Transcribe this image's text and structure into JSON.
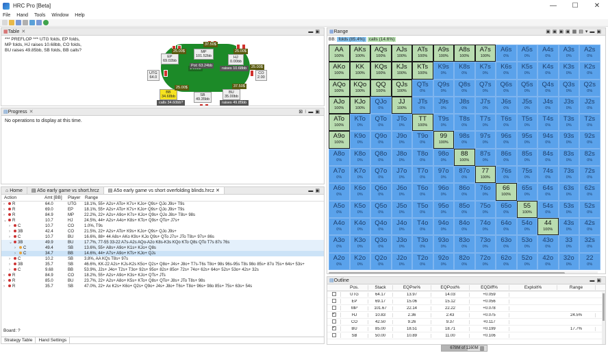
{
  "window": {
    "title": "HRC Pro [Beta]",
    "controls": [
      "—",
      "☐",
      "✕"
    ]
  },
  "menu": [
    "File",
    "Hand",
    "Tools",
    "Window",
    "Help"
  ],
  "panes": {
    "table": {
      "title": "Table",
      "preflop": "*** PREFLOP *** UTG folds, EP folds, MP folds, HJ raises 10.68bb, CO folds, BU raises 49.85bb, SB folds, BB calls?",
      "seats": [
        {
          "id": "ep",
          "name": "EP",
          "stack": "69.02bb"
        },
        {
          "id": "mp",
          "name": "MP",
          "stack": "101.52bb"
        },
        {
          "id": "hj",
          "name": "HJ",
          "stack": "0.00bb"
        },
        {
          "id": "utg",
          "name": "UTG",
          "stack": "64.0"
        },
        {
          "id": "co",
          "name": "CO",
          "stack": "2.00"
        },
        {
          "id": "bb",
          "name": "BB",
          "stack": "34.68bb"
        },
        {
          "id": "sb",
          "name": "SB",
          "stack": "49.35bb"
        },
        {
          "id": "bu",
          "name": "BU",
          "stack": "35.00bb"
        }
      ],
      "chips": [
        "25.00$",
        "37.50$",
        "25.00$",
        "25.00$",
        "37.50$",
        "25.00$"
      ],
      "pot": "Pot:  63.24bb",
      "blind_lbl": "1.00bb",
      "actions": {
        "hj": "raises 10.68bb",
        "bb": "calls 34.60bb?",
        "bu": "raises 49.85bb"
      }
    },
    "progress": {
      "title": "Progress",
      "message": "No operations to display at this time."
    },
    "range": {
      "title": "Range",
      "prefix": "BB:",
      "folds": "folds (85.4%)",
      "calls": "calls (14.6%)"
    },
    "outline": {
      "title": "Outline"
    }
  },
  "editor_tabs": [
    {
      "label": "Home",
      "active": false
    },
    {
      "label": "A5o early game vs short.hrcz",
      "active": false
    },
    {
      "label": "A5o early game vs short overfolding blinds.hrcz",
      "active": true
    }
  ],
  "strategy": {
    "headers": {
      "action": "Action",
      "amt": "Amt [BB]",
      "player": "Player",
      "range": "Range"
    },
    "rows": [
      {
        "indent": 0,
        "arrow": "›",
        "act": "R",
        "amt": "64.0",
        "player": "UTG",
        "range": "18.1%, 55+ A2s+ ATo+ K7s+ KJo+ Q9s+ QJo J9s+ T9s",
        "type": "normal",
        "dot": "#c33"
      },
      {
        "indent": 0,
        "arrow": "›",
        "act": "R",
        "amt": "69.0",
        "player": "EP",
        "range": "18.1%, 55+ A2s+ ATo+ K7s+ KJo+ Q9s+ QJo J9s+ T9s",
        "type": "normal",
        "dot": "#c33"
      },
      {
        "indent": 0,
        "arrow": "›",
        "act": "R",
        "amt": "84.9",
        "player": "MP",
        "range": "22.2%, 22+ A2s+ A9o+ K7s+ KJo+ Q9s+ QJo J8s+ T8s+ 98s",
        "type": "normal",
        "dot": "#c33"
      },
      {
        "indent": 0,
        "arrow": "⌄",
        "act": "R",
        "amt": "10.7",
        "player": "HJ",
        "range": "24.5%, 44+ A2s+ A4o+ K8s+ KTo+ Q9s+ QTo+ J7s+",
        "type": "normal",
        "dot": "#c33"
      },
      {
        "indent": 1,
        "arrow": "›",
        "act": "C",
        "amt": "10.7",
        "player": "CO",
        "range": "1.0%, T9s",
        "type": "normal",
        "dot": "#c33"
      },
      {
        "indent": 1,
        "arrow": "›",
        "act": "3B",
        "amt": "42.4",
        "player": "CO",
        "range": "21.5%, 22+ A2s+ ATo+ K9s+ KJo+ Q9s+ QJo J9s+",
        "type": "normal",
        "dot": "#c33"
      },
      {
        "indent": 1,
        "arrow": "›",
        "act": "C",
        "amt": "10.7",
        "player": "BU",
        "range": "16.6%, 88+ 44 A8s+ AKo K9s+ KJo Q9s+ QTo J7s+ JTo T8s+ 97s+ 86s",
        "type": "normal",
        "dot": "#c33"
      },
      {
        "indent": 1,
        "arrow": "⌄",
        "act": "3B",
        "amt": "49.9",
        "player": "BU",
        "range": "17.7%, 77-55 33-22 A7s-A2s AQo-A2o K8s-K3s KQo KTo Q8s QTo T7s 87s 76s",
        "type": "hl",
        "dot": "#c33"
      },
      {
        "indent": 2,
        "arrow": "›",
        "act": "C",
        "amt": "49.4",
        "player": "SB",
        "range": "13.6%, 55+ A8s+ A9o+ K1s+ KJo+ Q8s",
        "type": "hl",
        "dot": "#e8a33a"
      },
      {
        "indent": 2,
        "arrow": "›",
        "act": "C",
        "amt": "34.7",
        "player": "BB",
        "range": "14.6%, 44+ A7s+ A9o+ KTs+ KJo+ QJs",
        "type": "sel",
        "dot": "#e8a33a"
      },
      {
        "indent": 1,
        "arrow": "›",
        "act": "C",
        "amt": "10.2",
        "player": "SB",
        "range": "3.8%, AA KQs T8s+ 97s",
        "type": "normal",
        "dot": "#c33"
      },
      {
        "indent": 1,
        "arrow": "›",
        "act": "3B",
        "amt": "35.7",
        "player": "SB",
        "range": "46.6%, KK-22 A2s+ KJs-K2s K5o+ Q2s+ Q8o+ J4s+ J8o+ T7s-T6s T8o+ 98s 96s-95s T8s 98o 85s+ 87o 75s+ 64s+ 53s+",
        "type": "normal",
        "dot": "#c33"
      },
      {
        "indent": 1,
        "arrow": "›",
        "act": "C",
        "amt": "9.68",
        "player": "BB",
        "range": "53.9%, J2s+ J4o+ T2s+ T3o+ 92s+ 95o+ 82s+ 85o+ 72s+ 74o+ 62s+ 64o+ 52s+ 53o+ 42s+ 32s",
        "type": "normal",
        "dot": "#c33"
      },
      {
        "indent": 0,
        "arrow": "›",
        "act": "R",
        "amt": "84.9",
        "player": "CO",
        "range": "18.2%, 55+ A2s+ A9o+ K3s+ KJo+ QTs+ JTs",
        "type": "normal",
        "dot": "#c33"
      },
      {
        "indent": 0,
        "arrow": "›",
        "act": "R",
        "amt": "85.0",
        "player": "BU",
        "range": "23.7%, 22+ A2s+ A8o+ K5s+ KTo+ Q8s+ QTo+ J8s+ JTo T8s+ 98s",
        "type": "normal",
        "dot": "#c33"
      },
      {
        "indent": 0,
        "arrow": "›",
        "act": "R",
        "amt": "35.7",
        "player": "SB",
        "range": "47.0%, 22+ Ax K2s+ K6o+ Q2s+ Q9o+ J4s+ J8o+ T6s+ T8o+ 96s+ 98o 85s+ 75s+ 63s+ 54s",
        "type": "normal",
        "dot": "#c33"
      }
    ],
    "board": "Board: ?",
    "bottom_tabs": [
      "Strategy Table",
      "Hand Settings"
    ]
  },
  "range_grid": [
    [
      "AA",
      "AKs",
      "AQs",
      "AJs",
      "ATs",
      "A9s",
      "A8s",
      "A7s",
      "A6s",
      "A5s",
      "A4s",
      "A3s",
      "A2s"
    ],
    [
      "AKo",
      "KK",
      "KQs",
      "KJs",
      "KTs",
      "K9s",
      "K8s",
      "K7s",
      "K6s",
      "K5s",
      "K4s",
      "K3s",
      "K2s"
    ],
    [
      "AQo",
      "KQo",
      "QQ",
      "QJs",
      "QTs",
      "Q9s",
      "Q8s",
      "Q7s",
      "Q6s",
      "Q5s",
      "Q4s",
      "Q3s",
      "Q2s"
    ],
    [
      "AJo",
      "KJo",
      "QJo",
      "JJ",
      "JTs",
      "J9s",
      "J8s",
      "J7s",
      "J6s",
      "J5s",
      "J4s",
      "J3s",
      "J2s"
    ],
    [
      "ATo",
      "KTo",
      "QTo",
      "JTo",
      "TT",
      "T9s",
      "T8s",
      "T7s",
      "T6s",
      "T5s",
      "T4s",
      "T3s",
      "T2s"
    ],
    [
      "A9o",
      "K9o",
      "Q9o",
      "J9o",
      "T9o",
      "99",
      "98s",
      "97s",
      "96s",
      "95s",
      "94s",
      "93s",
      "92s"
    ],
    [
      "A8o",
      "K8o",
      "Q8o",
      "J8o",
      "T8o",
      "98o",
      "88",
      "87s",
      "86s",
      "85s",
      "84s",
      "83s",
      "82s"
    ],
    [
      "A7o",
      "K7o",
      "Q7o",
      "J7o",
      "T7o",
      "97o",
      "87o",
      "77",
      "76s",
      "75s",
      "74s",
      "73s",
      "72s"
    ],
    [
      "A6o",
      "K6o",
      "Q6o",
      "J6o",
      "T6o",
      "96o",
      "86o",
      "76o",
      "66",
      "65s",
      "64s",
      "63s",
      "62s"
    ],
    [
      "A5o",
      "K5o",
      "Q5o",
      "J5o",
      "T5o",
      "95o",
      "85o",
      "75o",
      "65o",
      "55",
      "54s",
      "53s",
      "52s"
    ],
    [
      "A4o",
      "K4o",
      "Q4o",
      "J4o",
      "T4o",
      "94o",
      "84o",
      "74o",
      "64o",
      "54o",
      "44",
      "43s",
      "42s"
    ],
    [
      "A3o",
      "K3o",
      "Q3o",
      "J3o",
      "T3o",
      "93o",
      "83o",
      "73o",
      "63o",
      "53o",
      "43o",
      "33",
      "32s"
    ],
    [
      "A2o",
      "K2o",
      "Q2o",
      "J2o",
      "T2o",
      "92o",
      "82o",
      "72o",
      "62o",
      "52o",
      "42o",
      "32o",
      "22"
    ]
  ],
  "range_calls": [
    "AA",
    "AKs",
    "AQs",
    "AJs",
    "ATs",
    "A9s",
    "A8s",
    "A7s",
    "AKo",
    "KK",
    "KQs",
    "KJs",
    "KTs",
    "AQo",
    "KQo",
    "QQ",
    "QJs",
    "AJo",
    "KJo",
    "JJ",
    "ATo",
    "TT",
    "A9o",
    "99",
    "88",
    "77",
    "66",
    "55",
    "44"
  ],
  "range_pct_call": "100%",
  "range_pct_fold": "0%",
  "outline_table": {
    "headers": [
      "",
      "Pos.",
      "Stack",
      "EQPre%",
      "EQPost%",
      "EQDiff%",
      "Exploit%",
      "Range"
    ],
    "rows": [
      {
        "checked": false,
        "pos": "UTG",
        "stack": "64.17",
        "pre": "13.97",
        "post": "14.03",
        "diff": "+0.059",
        "exploit": "",
        "range": ""
      },
      {
        "checked": false,
        "pos": "EP",
        "stack": "69.17",
        "pre": "15.06",
        "post": "15.12",
        "diff": "+0.056",
        "exploit": "",
        "range": ""
      },
      {
        "checked": false,
        "pos": "MP",
        "stack": "101.67",
        "pre": "22.14",
        "post": "22.22",
        "diff": "+0.078",
        "exploit": "",
        "range": ""
      },
      {
        "checked": true,
        "pos": "HJ",
        "stack": "10.83",
        "pre": "2.36",
        "post": "2.43",
        "diff": "+0.075",
        "exploit": "",
        "range": "24.5%"
      },
      {
        "checked": false,
        "pos": "CO",
        "stack": "42.50",
        "pre": "9.26",
        "post": "9.37",
        "diff": "+0.117",
        "exploit": "",
        "range": ""
      },
      {
        "checked": true,
        "pos": "BU",
        "stack": "85.00",
        "pre": "18.51",
        "post": "18.71",
        "diff": "+0.199",
        "exploit": "",
        "range": "17.7%"
      },
      {
        "checked": false,
        "pos": "SB",
        "stack": "50.00",
        "pre": "10.89",
        "post": "11.00",
        "diff": "+0.106",
        "exploit": "",
        "range": ""
      }
    ]
  },
  "memory": "678M of 1160M",
  "memory_fraction": 0.58
}
